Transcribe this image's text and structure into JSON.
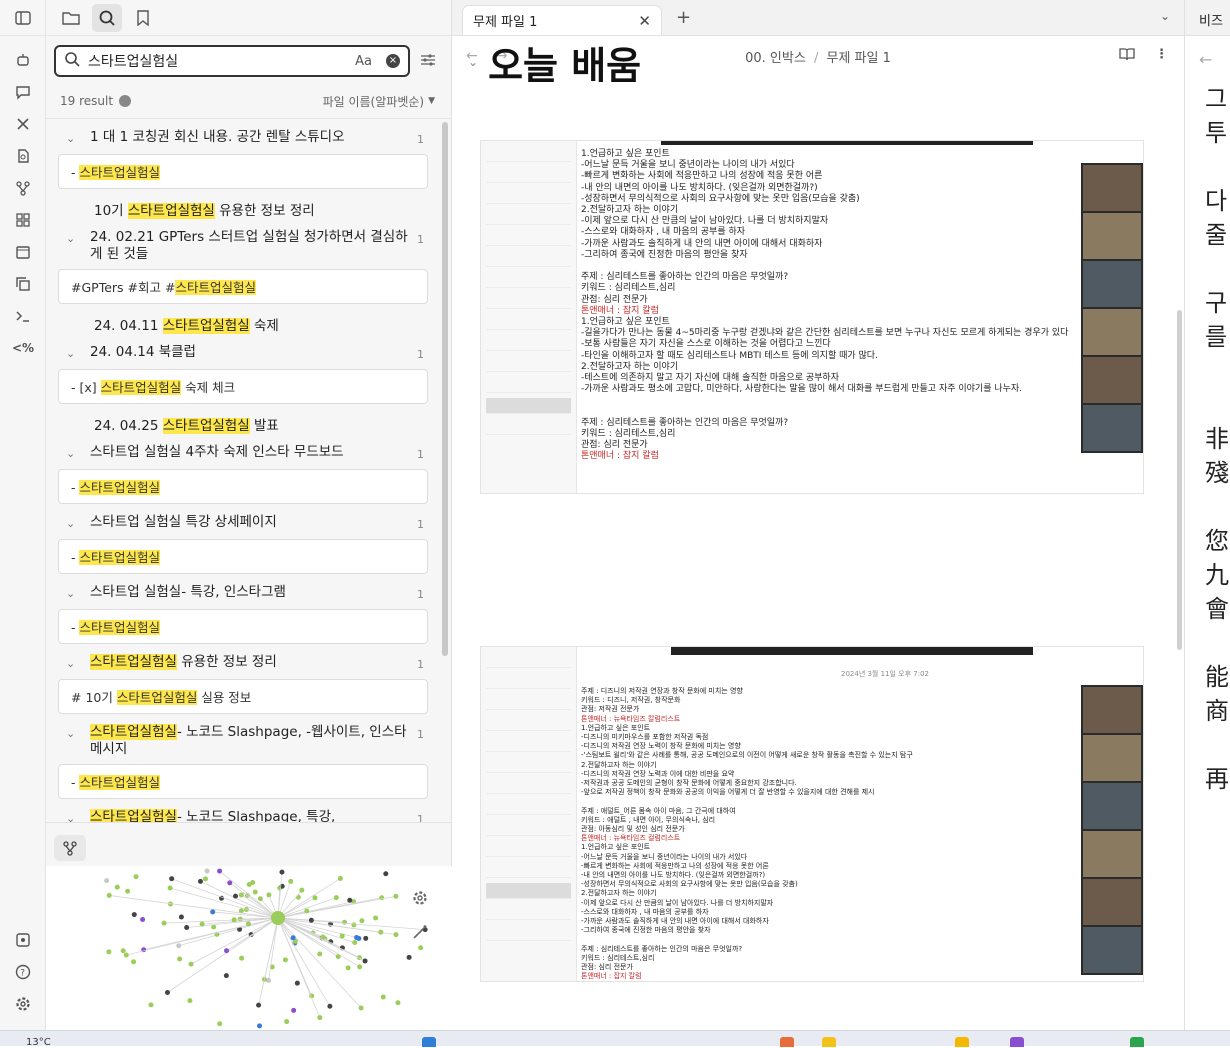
{
  "search": {
    "query": "스타트업실험실",
    "case_toggle": "Aa",
    "result_count": "19 result",
    "sort_label": "파일 이름(알파벳순)"
  },
  "results": [
    {
      "type": "group",
      "title": "1 대 1 코칭권 회신 내용. 공간 렌탈 스튜디오",
      "count": "1",
      "snippet": [
        {
          "t": "- "
        },
        {
          "t": "스타트업실험실",
          "h": true
        }
      ]
    },
    {
      "type": "plain",
      "parts": [
        {
          "t": "10기 "
        },
        {
          "t": "스타트업실험실",
          "h": true
        },
        {
          "t": " 유용한 정보 정리"
        }
      ]
    },
    {
      "type": "group",
      "title": "24. 02.21 GPTers 스터트업 실험실 청가하면서 결심하게 된 것들",
      "count": "1",
      "snippet": [
        {
          "t": "#GPTers  #회고 #"
        },
        {
          "t": "스타트업실험실",
          "h": true
        }
      ]
    },
    {
      "type": "plain",
      "parts": [
        {
          "t": "24. 04.11 "
        },
        {
          "t": "스타트업실험실",
          "h": true
        },
        {
          "t": " 숙제"
        }
      ]
    },
    {
      "type": "group",
      "title": "24. 04.14 북클럽",
      "count": "1",
      "snippet": [
        {
          "t": "- [x] "
        },
        {
          "t": "스타트업실험실",
          "h": true
        },
        {
          "t": " 숙제 체크"
        }
      ]
    },
    {
      "type": "plain",
      "parts": [
        {
          "t": "24. 04.25 "
        },
        {
          "t": "스타트업실험실",
          "h": true
        },
        {
          "t": " 발표"
        }
      ]
    },
    {
      "type": "group",
      "title": "스타트업 실험실 4주차 숙제 인스타 무드보드",
      "count": "1",
      "snippet": [
        {
          "t": "- "
        },
        {
          "t": "스타트업실험실",
          "h": true
        }
      ]
    },
    {
      "type": "group",
      "title": "스타트업 실험실 특강 상세페이지",
      "count": "1",
      "snippet": [
        {
          "t": "- "
        },
        {
          "t": "스타트업실험실",
          "h": true
        }
      ]
    },
    {
      "type": "group",
      "title": "스타트업 실험실- 특강, 인스타그램",
      "count": "1",
      "snippet": [
        {
          "t": "- "
        },
        {
          "t": "스타트업실험실",
          "h": true
        }
      ]
    },
    {
      "type": "group",
      "title_parts": [
        {
          "t": "스타트업실험실",
          "h": true
        },
        {
          "t": " 유용한 정보 정리"
        }
      ],
      "count": "1",
      "snippet": [
        {
          "t": "# 10기  "
        },
        {
          "t": "스타트업실험실",
          "h": true
        },
        {
          "t": " 실용 정보"
        }
      ]
    },
    {
      "type": "group",
      "title_parts": [
        {
          "t": "스타트업실험실",
          "h": true
        },
        {
          "t": "- 노코드 Slashpage, -웹사이트, 인스타 메시지"
        }
      ],
      "count": "1",
      "snippet": [
        {
          "t": "- "
        },
        {
          "t": "스타트업실험실",
          "h": true
        }
      ]
    },
    {
      "type": "group",
      "title_parts": [
        {
          "t": "스타트업실험실",
          "h": true
        },
        {
          "t": "- 노코드 Slashpage, 특강,"
        }
      ],
      "count": "1",
      "snippet": []
    }
  ],
  "editor": {
    "tab_title": "무제 파일 1",
    "breadcrumb_folder": "00. 인박스",
    "breadcrumb_sep": "/",
    "breadcrumb_file": "무제 파일 1",
    "heading": "오늘 배움"
  },
  "shot1": {
    "lines": [
      "1.언급하고 싶은 포인트",
      "-어느날 문득 거울을 보니 중년이라는 나이의 내가 서있다",
      "-빠르게 변화하는 사회에 적응만하고 나의 성장에 적응 못한 어른",
      "-내 안의 내면의 아이를 나도 방치하다. (잊은걸까 외면한걸까?)",
      "-성장하면서 무의식적으로 사회의 요구사항에 맞는 옷만 입음(모습을 갖춤)",
      "2.전달하고자 하는 이야기",
      "-이제 앞으로 다시 산 만큼의 날이 남아있다. 나를 더 방치하지말자",
      "-스스로와 대화하자 , 내 마음의 공부를 하자",
      "-가까운 사람과도 솔직하게 내 안의 내면 아이에 대해서 대화하자",
      "-그리하여 종국에 진정한 마음의 평안을 찾자",
      "",
      "주제 : 심리테스트를 좋아하는 인간의 마음은 무엇일까?",
      "키워드 : 심리테스트,심리",
      "관점: 심리 전문가",
      "톤앤매너 : 잡지 칼럼",
      "1.언급하고 싶은 포인트",
      "-길을가다가 만나는 동물 4~5마리중 누구랑 걷겠냐와 같은 간단한 심리테스트를 보면 누구나 자신도 모르게 하게되는 경우가 있다",
      "-보통 사람들은 자기 자신을 스스로 이해하는 것을 어렵다고 느낀다",
      "-타인을 이해하고자 할 때도 심리테스트나 MBTI 테스트 등에 의지할 때가 많다.",
      "2.전달하고자 하는 이야기",
      "-테스트에 의존하지 말고 자기 자신에 대해 솔직한 마음으로 공부하자",
      "-가까운 사람과도 평소에 고맙다, 미안하다, 사랑한다는 말을 많이 해서 대화를 부드럽게 만들고 자주 이야기를 나누자.",
      "",
      "",
      "주제 : 심리테스트를 좋아하는 인간의 마음은 무엇일까?",
      "키워드 : 심리테스트,심리",
      "관점: 심리 전문가",
      "톤앤매너 : 잡지 칼럼"
    ]
  },
  "shot2": {
    "date": "2024년 3월 11일 오후 7:02",
    "lines": [
      "주제 : 디즈니의 저작권 연장과 창작 문화에 미치는 영향",
      "키워드 : 디즈니, 저작권, 창작문화",
      "관점: 저작권 전문가",
      "톤앤매너 : 뉴욕타임즈 칼럼리스트",
      "1.언급하고 싶은 포인트",
      "-디즈니의 미키마우스를 포함한 저작권 독점",
      "-디즈니의 저작권 연장 노력이 창작 문화에 미치는 영향",
      "-'스팀보트 윌리'와 같은 사례를 통해, 공공 도메인으로의 이전이 어떻게 새로운 창작 활동을 촉진할 수 있는지 탐구",
      "2.전달하고자 하는 이야기",
      "-디즈니의 저작권 연장 노력과 이에 대한 비판을 요약",
      "-저작권과 공공 도메인의 균형이 창작 문화에 어떻게 중요한지 강조합니다.",
      "-앞으로 저작권 정책이 창작 문화와 공공의 이익을 어떻게 더 잘 반영할 수 있을지에 대한 견해를 제시",
      "",
      "주제 : 애덜트_어른 몸속 아이 마음, 그 간극에 대하여",
      "키워드 : 애덜트 , 내면 아이, 무의식속나, 심리",
      "관점: 아동심리 및 성인 심리 전문가",
      "톤앤매너 : 뉴욕타임즈 컬럼리스트",
      "1.언급하고 싶은 포인트",
      "-어느날 문득 거울을 보니 중년이라는 나이의 내가 서있다",
      "-빠르게 변화하는 사회에 적응만하고 나의 성장에 적응 못한 어른",
      "-내 안의 내면의 아이를 나도 방치하다. (잊은걸까 외면한걸까?)",
      "-성장하면서 무의식적으로 사회의 요구사항에 맞는 옷만 입음(모습을 갖춤)",
      "2.전달하고자 하는 이야기",
      "-이제 앞으로 다시 산 만큼의 날이 남아있다. 나를 더 방치하지말자",
      "-스스로와 대화하자 , 내 마음의 공부를 하자",
      "-가까운 사람과도 솔직하게 내 안의 내면 아이에 대해서 대화하자",
      "-그리하여 종국에 진정한 마음의 평안을 찾자",
      "",
      "주제 : 심리테스트를 좋아하는 인간의 마음은 무엇일까?",
      "키워드 : 심리테스트,심리",
      "관점: 심리 전문가",
      "톤앤매너 : 잡지 칼럼"
    ]
  },
  "right_pane": {
    "tab_title": "비즈",
    "glyphs": "그\n투\n\n다\n줄\n\n구\n를\n\n\n非\n殘\n\n您\n九\n會\n\n能\n商\n\n再"
  },
  "taskbar": {
    "weather": "13°C"
  },
  "colors": {
    "highlight": "#fde74c",
    "accent_red": "#c62828"
  }
}
